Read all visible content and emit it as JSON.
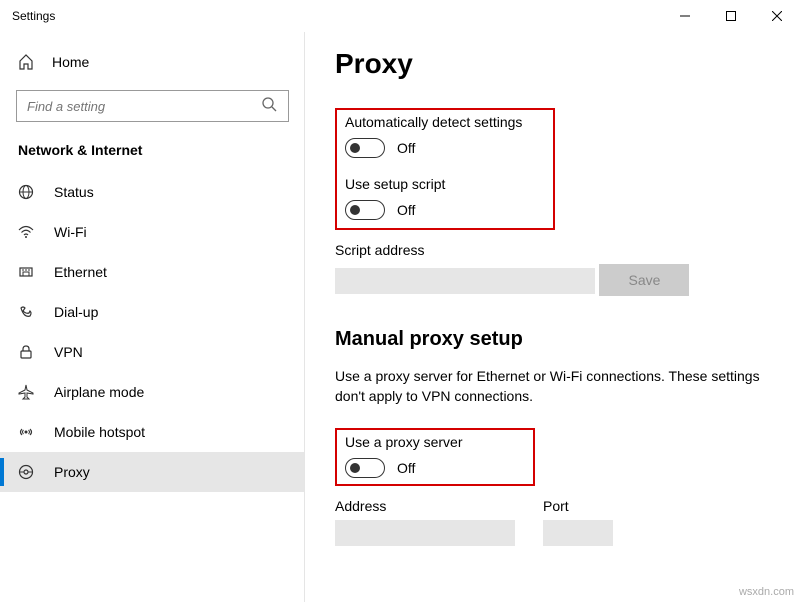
{
  "window": {
    "title": "Settings"
  },
  "sidebar": {
    "home_label": "Home",
    "search_placeholder": "Find a setting",
    "category_label": "Network & Internet",
    "items": [
      {
        "label": "Status"
      },
      {
        "label": "Wi-Fi"
      },
      {
        "label": "Ethernet"
      },
      {
        "label": "Dial-up"
      },
      {
        "label": "VPN"
      },
      {
        "label": "Airplane mode"
      },
      {
        "label": "Mobile hotspot"
      },
      {
        "label": "Proxy"
      }
    ]
  },
  "main": {
    "title": "Proxy",
    "auto_detect_label": "Automatically detect settings",
    "auto_detect_state": "Off",
    "setup_script_label": "Use setup script",
    "setup_script_state": "Off",
    "script_address_label": "Script address",
    "save_label": "Save",
    "manual_title": "Manual proxy setup",
    "manual_desc": "Use a proxy server for Ethernet or Wi-Fi connections. These settings don't apply to VPN connections.",
    "use_proxy_label": "Use a proxy server",
    "use_proxy_state": "Off",
    "address_label": "Address",
    "port_label": "Port"
  },
  "watermark": "wsxdn.com"
}
